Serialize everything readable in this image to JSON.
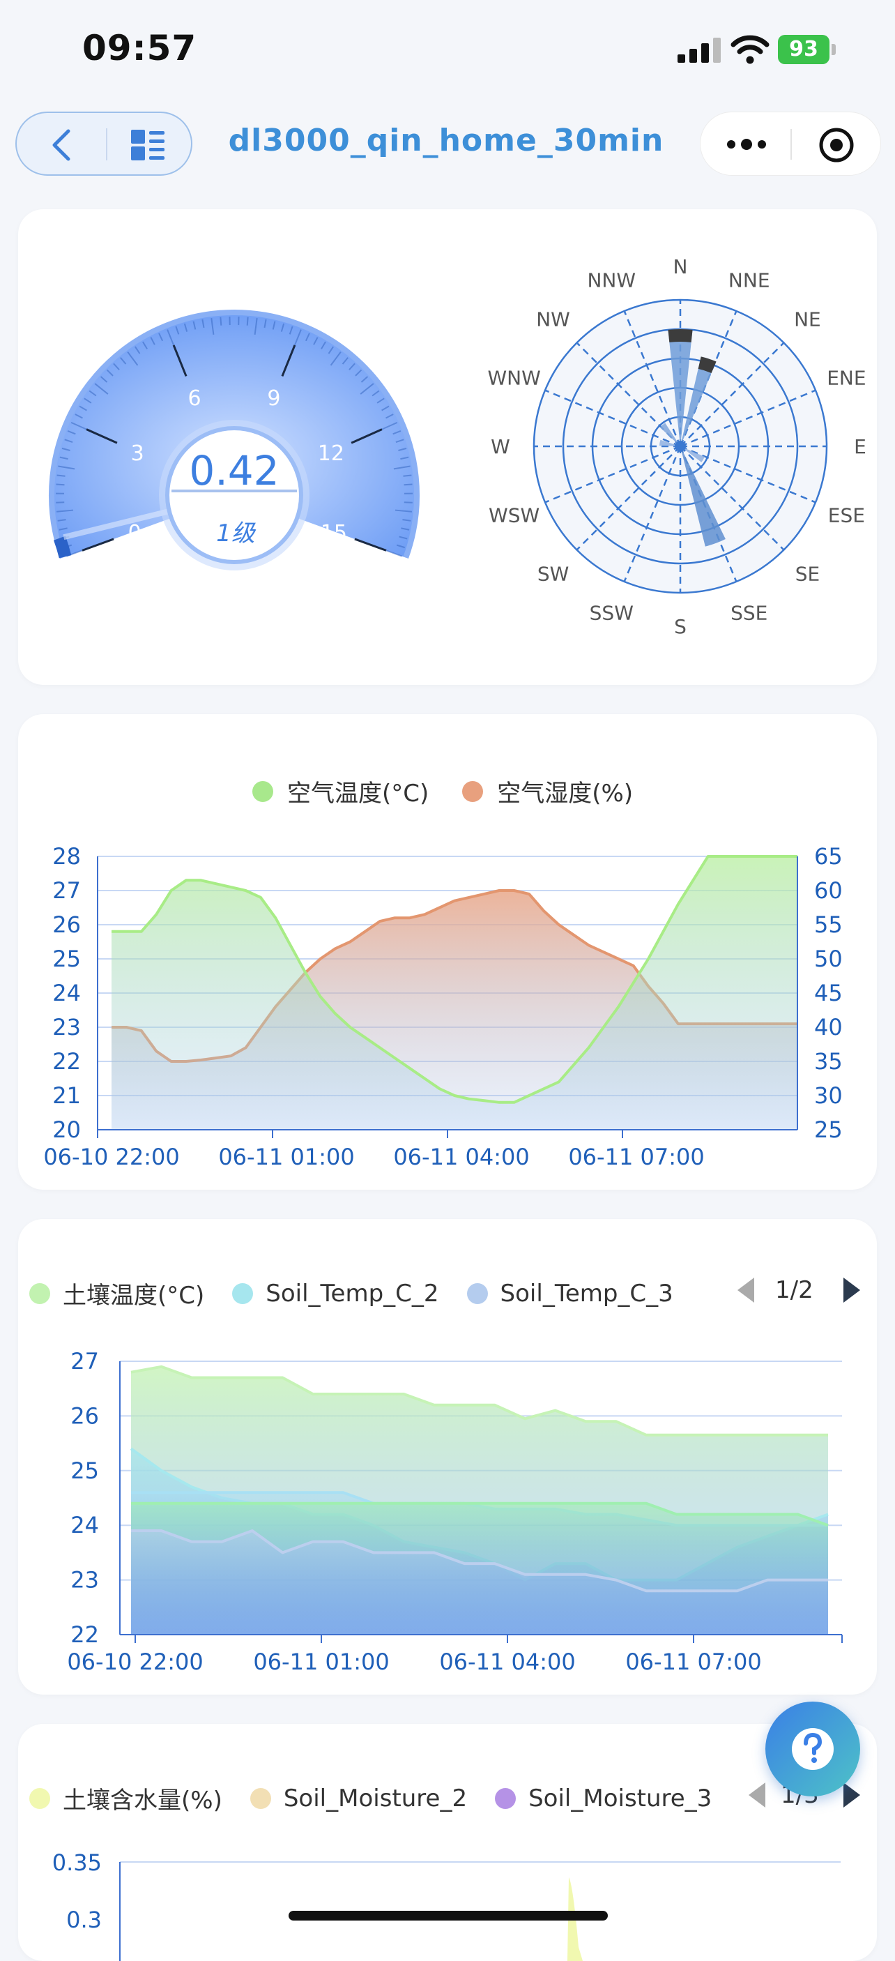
{
  "status_bar": {
    "time": "09:57",
    "battery": "93"
  },
  "nav": {
    "title": "dl3000_qin_home_30min"
  },
  "gauge": {
    "value": "0.42",
    "level": "1级",
    "ticks": [
      "0",
      "3",
      "6",
      "9",
      "12",
      "15"
    ],
    "max": 15,
    "current": 0.42
  },
  "wind_rose": {
    "directions": [
      "N",
      "NNE",
      "NE",
      "ENE",
      "E",
      "ESE",
      "SE",
      "SSE",
      "S",
      "SSW",
      "SW",
      "WSW",
      "W",
      "WNW",
      "NW",
      "NNW"
    ],
    "rings": 5
  },
  "air_chart": {
    "legend": [
      {
        "label": "空气温度(°C)",
        "color": "#a8e88c"
      },
      {
        "label": "空气湿度(%)",
        "color": "#e8a07e"
      }
    ]
  },
  "soil_temp_chart": {
    "legend": [
      {
        "label": "土壤温度(°C)",
        "color": "#c2f2b0"
      },
      {
        "label": "Soil_Temp_C_2",
        "color": "#a6e6ee"
      },
      {
        "label": "Soil_Temp_C_3",
        "color": "#b4ccee"
      }
    ],
    "page": "1/2"
  },
  "moisture_chart": {
    "legend": [
      {
        "label": "土壤含水量(%)",
        "color": "#f1f8b0"
      },
      {
        "label": "Soil_Moisture_2",
        "color": "#f2dfb4"
      },
      {
        "label": "Soil_Moisture_3",
        "color": "#b592e6"
      }
    ],
    "page": "1/3",
    "y_ticks": [
      "0.35",
      "0.3"
    ]
  },
  "chart_data": [
    {
      "type": "area",
      "x_ticks": [
        "06-10 22:00",
        "06-11 01:00",
        "06-11 04:00",
        "06-11 07:00"
      ],
      "y_left_ticks": [
        "20",
        "21",
        "22",
        "23",
        "24",
        "25",
        "26",
        "27",
        "28"
      ],
      "y_right_ticks": [
        "25",
        "30",
        "35",
        "40",
        "45",
        "50",
        "55",
        "60",
        "65"
      ],
      "ylim_left": [
        20,
        28
      ],
      "ylim_right": [
        25,
        65
      ],
      "x": [
        0,
        0.5,
        1,
        1.5,
        2,
        2.5,
        3,
        3.5,
        4,
        4.5,
        5,
        5.5,
        6,
        6.5,
        7,
        7.5,
        8,
        8.5,
        9,
        9.5,
        10,
        10.5,
        11,
        11.5,
        12,
        12.5,
        13,
        13.5,
        14,
        14.5,
        15,
        15.5,
        16,
        16.5,
        17,
        17.5,
        18,
        18.5,
        19,
        19.5,
        20,
        20.5,
        21,
        21.5,
        22,
        22.5,
        23
      ],
      "series": [
        {
          "name": "空气温度(°C)",
          "axis": "left",
          "values": [
            25.8,
            25.8,
            25.8,
            26.3,
            27.0,
            27.3,
            27.3,
            27.2,
            27.1,
            27.0,
            26.8,
            26.2,
            25.4,
            24.6,
            23.9,
            23.4,
            23.0,
            22.7,
            22.4,
            22.1,
            21.8,
            21.5,
            21.2,
            21.0,
            20.9,
            20.85,
            20.8,
            20.8,
            21.0,
            21.2,
            21.4,
            21.9,
            22.4,
            23.0,
            23.6,
            24.3,
            25.0,
            25.8,
            26.6,
            27.3,
            28.0,
            28.0,
            28.0,
            28.0,
            28.0,
            28.0,
            28.0
          ]
        },
        {
          "name": "空气湿度(%)",
          "axis": "right",
          "values": [
            40.0,
            40.0,
            39.5,
            36.5,
            35.0,
            35.0,
            35.2,
            35.5,
            35.8,
            37.0,
            40.0,
            43.0,
            45.5,
            48.0,
            50.0,
            51.5,
            52.5,
            54.0,
            55.5,
            56.0,
            56.0,
            56.5,
            57.5,
            58.5,
            59.0,
            59.5,
            60.0,
            60.0,
            59.5,
            57.0,
            55.0,
            53.5,
            52.0,
            51.0,
            50.0,
            49.0,
            46.0,
            43.5,
            40.5,
            40.5,
            40.5,
            40.5,
            40.5,
            40.5,
            40.5,
            40.5,
            40.5
          ]
        }
      ]
    },
    {
      "type": "area",
      "x_ticks": [
        "06-10 22:00",
        "06-11 01:00",
        "06-11 04:00",
        "06-11 07:00"
      ],
      "y_ticks": [
        "22",
        "23",
        "24",
        "25",
        "26",
        "27"
      ],
      "ylim": [
        22,
        27
      ],
      "x": [
        0,
        1,
        2,
        3,
        4,
        5,
        6,
        7,
        8,
        9,
        10,
        11,
        12,
        13,
        14,
        15,
        16,
        17,
        18,
        19,
        20,
        21,
        22,
        23
      ],
      "series": [
        {
          "name": "土壤温度(°C)",
          "values": [
            26.8,
            26.9,
            26.7,
            26.7,
            26.7,
            26.7,
            26.4,
            26.4,
            26.4,
            26.4,
            26.2,
            26.2,
            26.2,
            25.95,
            26.1,
            25.9,
            25.9,
            25.65,
            25.65,
            25.65,
            25.65,
            25.65,
            25.65,
            25.65
          ]
        },
        {
          "name": "Soil_Temp_C_2",
          "values": [
            25.4,
            25.0,
            24.7,
            24.5,
            24.4,
            24.4,
            24.2,
            24.2,
            24.0,
            23.7,
            23.6,
            23.5,
            23.3,
            23.0,
            23.3,
            23.3,
            23.0,
            23.0,
            23.0,
            23.3,
            23.6,
            23.8,
            24.0,
            24.2
          ]
        },
        {
          "name": "Soil_Temp_C_3",
          "values": [
            23.9,
            23.9,
            23.7,
            23.7,
            23.9,
            23.5,
            23.7,
            23.7,
            23.5,
            23.5,
            23.5,
            23.3,
            23.3,
            23.1,
            23.1,
            23.1,
            23.0,
            22.8,
            22.8,
            22.8,
            22.8,
            23.0,
            23.0,
            23.0
          ]
        },
        {
          "name": "",
          "values": [
            24.4,
            24.4,
            24.4,
            24.4,
            24.4,
            24.4,
            24.4,
            24.4,
            24.4,
            24.4,
            24.4,
            24.4,
            24.4,
            24.4,
            24.4,
            24.4,
            24.4,
            24.4,
            24.2,
            24.2,
            24.2,
            24.2,
            24.2,
            24.0
          ]
        },
        {
          "name": "",
          "values": [
            24.6,
            24.6,
            24.6,
            24.6,
            24.6,
            24.6,
            24.6,
            24.6,
            24.4,
            24.4,
            24.4,
            24.4,
            24.3,
            24.3,
            24.3,
            24.2,
            24.2,
            24.1,
            24.0,
            24.0,
            24.0,
            24.0,
            24.0,
            24.0
          ]
        }
      ]
    }
  ]
}
